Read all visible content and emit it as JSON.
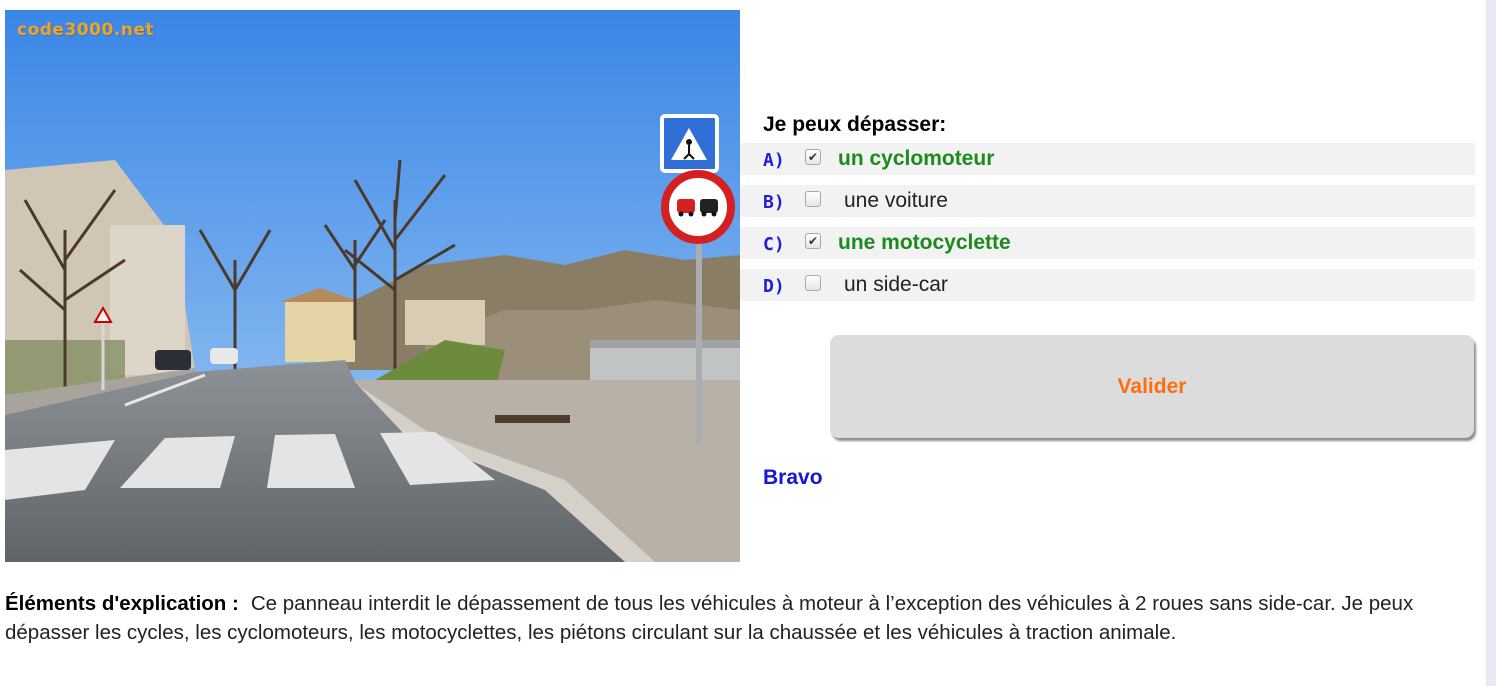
{
  "photo": {
    "watermark": "code3000.net",
    "alt": "road-scene-with-no-overtaking-sign"
  },
  "quiz": {
    "question": "Je peux dépasser:",
    "answers": [
      {
        "letter": "A)",
        "text": "un cyclomoteur",
        "checked": true,
        "state": "correct"
      },
      {
        "letter": "B)",
        "text": "une voiture",
        "checked": false,
        "state": "normal"
      },
      {
        "letter": "C)",
        "text": "une motocyclette",
        "checked": true,
        "state": "correct"
      },
      {
        "letter": "D)",
        "text": "un side-car",
        "checked": false,
        "state": "normal"
      }
    ],
    "validate_label": "Valider",
    "feedback": "Bravo"
  },
  "explanation": {
    "label": "Éléments d'explication :",
    "text": "Ce panneau interdit le dépassement de tous les véhicules à moteur à l’exception des véhicules à 2 roues sans side-car. Je peux dépasser les cycles, les cyclomoteurs, les motocyclettes, les piétons circulant sur la chaussée et les véhicules à traction animale."
  },
  "colors": {
    "correct": "#1c8a1c",
    "letter": "#1f1fd6",
    "validate_text": "#ff6d10",
    "feedback": "#1616d8",
    "row_background": "#f2f2f2"
  },
  "icons": {
    "checkbox_checked": "check-mark-icon",
    "pedestrian_crossing_sign": "pedestrian-crossing-sign-icon",
    "no_overtaking_sign": "no-overtaking-sign-icon"
  }
}
